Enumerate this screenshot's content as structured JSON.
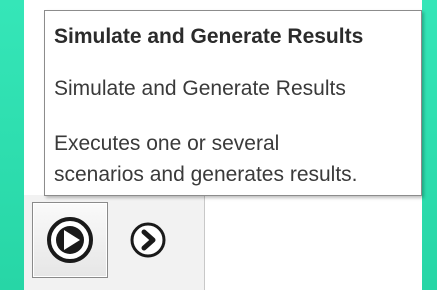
{
  "tooltip": {
    "title": "Simulate and Generate Results",
    "subtitle": "Simulate and Generate Results",
    "description_line1": "Executes one or several",
    "description_line2": "scenarios and generates results."
  },
  "ribbon": {
    "run_button_icon": "play-circle-icon",
    "next_button_icon": "chevron-right-circle-icon"
  },
  "colors": {
    "background": "#2fe0b0",
    "panel": "#ffffff",
    "tooltip_border": "#8c8c8c",
    "icon": "#1a1a1a"
  }
}
